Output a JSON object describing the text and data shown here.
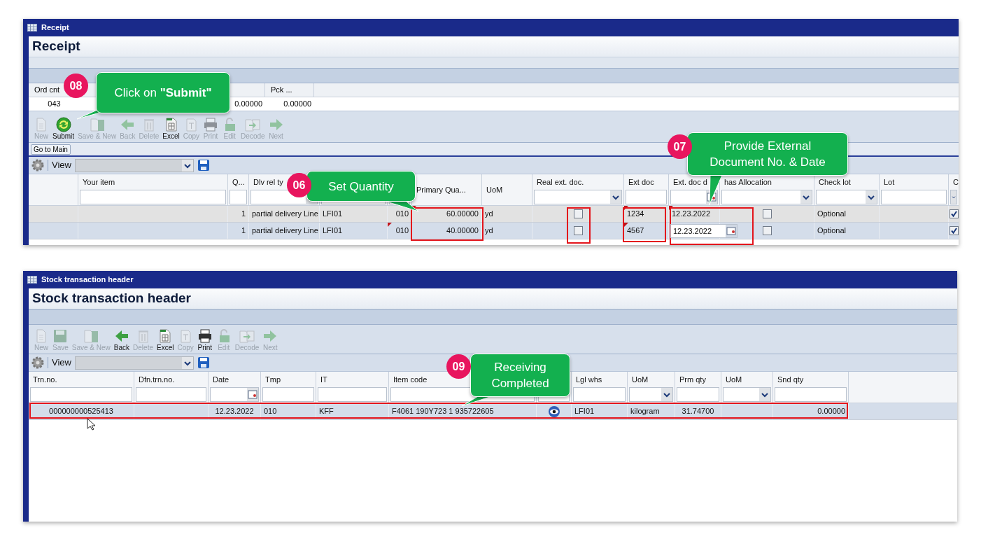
{
  "receipt_window": {
    "title": "Receipt",
    "heading": "Receipt",
    "order_grid": {
      "columns": [
        {
          "label": "Ord cnt",
          "value": "043"
        },
        {
          "value": "0.00000"
        },
        {
          "label": "Pck ...",
          "value": "0.00000"
        }
      ]
    },
    "toolbar": [
      {
        "label": "New",
        "disabled": true
      },
      {
        "label": "Submit",
        "disabled": false
      },
      {
        "label": "Save & New",
        "disabled": true
      },
      {
        "label": "Back",
        "disabled": true
      },
      {
        "label": "Delete",
        "disabled": true
      },
      {
        "label": "Excel",
        "disabled": false
      },
      {
        "label": "Copy",
        "disabled": true
      },
      {
        "label": "Print",
        "disabled": true
      },
      {
        "label": "Edit",
        "disabled": true
      },
      {
        "label": "Decode",
        "disabled": true
      },
      {
        "label": "Next",
        "disabled": true
      }
    ],
    "go_to_main": "Go to Main",
    "view_label": "View",
    "grid": {
      "columns": [
        {
          "kind": "plain"
        },
        {
          "label": "Your item",
          "kind": "text"
        },
        {
          "label": "Q...",
          "kind": "text"
        },
        {
          "label": "Dlv rel ty",
          "kind": "dropdown"
        },
        {
          "kind": "text"
        },
        {
          "kind": "text"
        },
        {
          "label": "Primary Qua...",
          "kind": "plain"
        },
        {
          "label": "UoM",
          "kind": "plain"
        },
        {
          "label": "Real ext. doc.",
          "kind": "dropdown"
        },
        {
          "label": "Ext doc",
          "kind": "text"
        },
        {
          "label": "Ext. doc d",
          "kind": "date"
        },
        {
          "label": "has Allocation",
          "kind": "dropdown"
        },
        {
          "label": "Check lot",
          "kind": "dropdown"
        },
        {
          "label": "Lot",
          "kind": "text"
        },
        {
          "label": "C",
          "kind": "dropdown"
        }
      ],
      "rows": [
        {
          "selected": false,
          "cells": [
            {
              "kind": "text"
            },
            {
              "kind": "text"
            },
            {
              "kind": "text",
              "text": "1"
            },
            {
              "kind": "text",
              "text": "partial delivery Line"
            },
            {
              "kind": "text",
              "text": "LFI01"
            },
            {
              "kind": "text",
              "text": "010"
            },
            {
              "kind": "text",
              "text": "60.00000",
              "marked": true
            },
            {
              "kind": "text",
              "text": "yd"
            },
            {
              "kind": "checkbox",
              "checked": false
            },
            {
              "kind": "text",
              "text": "1234",
              "marked": true
            },
            {
              "kind": "text",
              "text": "12.23.2022",
              "marked": true
            },
            {
              "kind": "checkbox",
              "checked": false
            },
            {
              "kind": "text",
              "text": "Optional"
            },
            {
              "kind": "text"
            },
            {
              "kind": "checkbox",
              "checked": true
            }
          ]
        },
        {
          "selected": true,
          "cells": [
            {
              "kind": "text"
            },
            {
              "kind": "text"
            },
            {
              "kind": "text",
              "text": "1"
            },
            {
              "kind": "text",
              "text": "partial delivery Line"
            },
            {
              "kind": "text",
              "text": "LFI01"
            },
            {
              "kind": "text",
              "text": "010",
              "marked": true
            },
            {
              "kind": "text",
              "text": "40.00000"
            },
            {
              "kind": "text",
              "text": "yd"
            },
            {
              "kind": "checkbox",
              "checked": false
            },
            {
              "kind": "text",
              "text": "4567",
              "marked": true
            },
            {
              "kind": "date-input",
              "text": "12.23.2022"
            },
            {
              "kind": "checkbox",
              "checked": false
            },
            {
              "kind": "text",
              "text": "Optional"
            },
            {
              "kind": "text"
            },
            {
              "kind": "checkbox",
              "checked": true
            }
          ]
        }
      ]
    }
  },
  "stock_window": {
    "title": "Stock transaction header",
    "heading": "Stock transaction header",
    "toolbar": [
      {
        "label": "New",
        "disabled": true
      },
      {
        "label": "Save",
        "disabled": true
      },
      {
        "label": "Save & New",
        "disabled": true
      },
      {
        "label": "Back",
        "disabled": false
      },
      {
        "label": "Delete",
        "disabled": true
      },
      {
        "label": "Excel",
        "disabled": false
      },
      {
        "label": "Copy",
        "disabled": true
      },
      {
        "label": "Print",
        "disabled": false
      },
      {
        "label": "Edit",
        "disabled": true
      },
      {
        "label": "Decode",
        "disabled": true
      },
      {
        "label": "Next",
        "disabled": true
      }
    ],
    "view_label": "View",
    "grid": {
      "columns": [
        {
          "label": "Trn.no.",
          "kind": "text"
        },
        {
          "label": "Dfn.trn.no.",
          "kind": "text"
        },
        {
          "label": "Date",
          "kind": "date"
        },
        {
          "label": "Tmp",
          "kind": "text"
        },
        {
          "label": "IT",
          "kind": "text"
        },
        {
          "label": "Item code",
          "kind": "text"
        },
        {
          "kind": "text"
        },
        {
          "label": "Lgl whs",
          "kind": "text"
        },
        {
          "label": "UoM",
          "kind": "dropdown"
        },
        {
          "label": "Prm qty",
          "kind": "text"
        },
        {
          "label": "UoM",
          "kind": "dropdown"
        },
        {
          "label": "Snd qty",
          "kind": "text"
        }
      ],
      "rows": [
        {
          "selected": true,
          "cells": [
            {
              "kind": "text",
              "text": "000000000525413"
            },
            {
              "kind": "text"
            },
            {
              "kind": "text",
              "text": "12.23.2022"
            },
            {
              "kind": "text",
              "text": "010"
            },
            {
              "kind": "text",
              "text": "KFF"
            },
            {
              "kind": "text",
              "text": "F4061 190Y723 1 935722605"
            },
            {
              "kind": "icon"
            },
            {
              "kind": "text",
              "text": "LFI01"
            },
            {
              "kind": "text",
              "text": "kilogram"
            },
            {
              "kind": "text",
              "text": "31.74700"
            },
            {
              "kind": "text"
            },
            {
              "kind": "text",
              "text": "0.00000"
            }
          ]
        }
      ]
    }
  },
  "callouts": [
    {
      "number": "08",
      "text": "Click on **\"Submit\"**"
    },
    {
      "number": "06",
      "text": "Set Quantity"
    },
    {
      "number": "07",
      "text": "Provide External Document No. & Date"
    },
    {
      "number": "09",
      "text": "Receiving Completed"
    }
  ]
}
